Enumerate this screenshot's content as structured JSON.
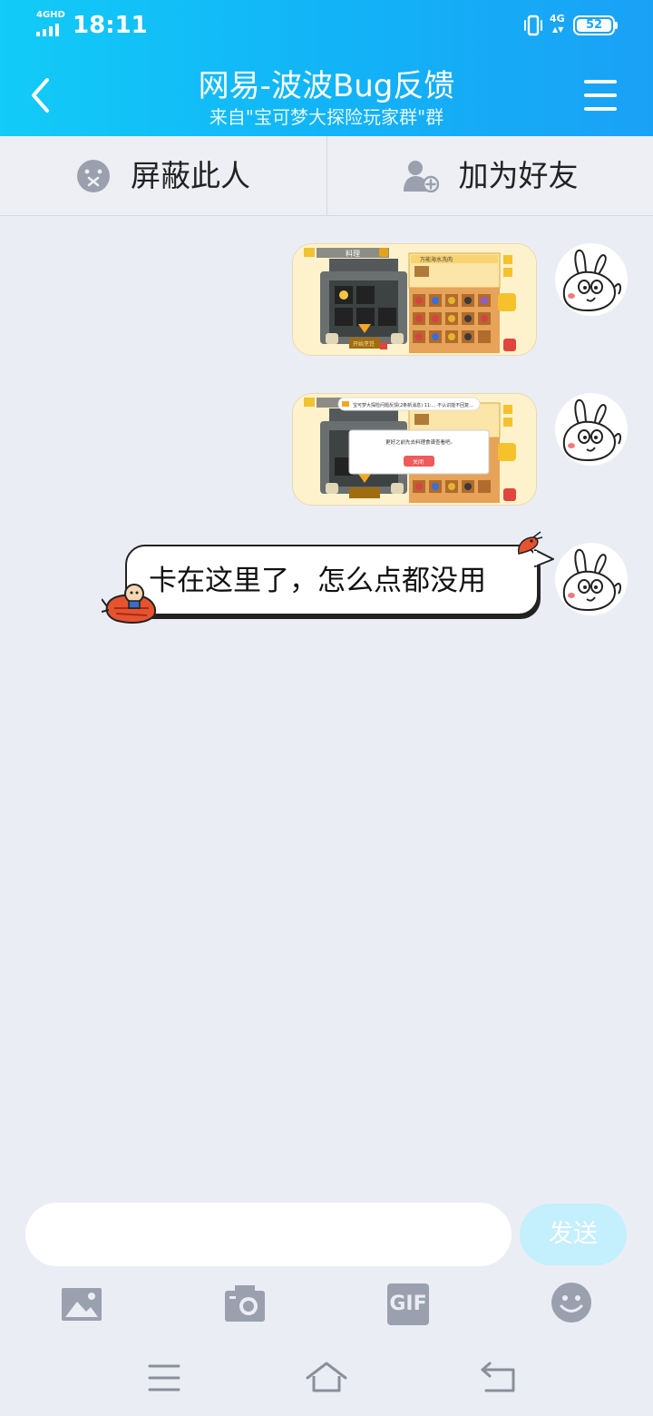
{
  "status_bar": {
    "network_label": "4GHD",
    "time": "18:11",
    "data_label": "4G",
    "battery": "52"
  },
  "header": {
    "title": "网易-波波Bug反馈",
    "subtitle": "来自\"宝可梦大探险玩家群\"群"
  },
  "actions": {
    "block_label": "屏蔽此人",
    "add_friend_label": "加为好友"
  },
  "messages": {
    "screenshot1": {
      "panel_title": "料理",
      "cook_button": "开始烹饪",
      "recipe_label": "万能海水洗肉"
    },
    "screenshot2": {
      "dialog_text": "更好之前先去料理食谱查看吧。",
      "dialog_button": "关闭",
      "banner_text": "宝可梦大探险问题反馈(2条新消息) 11:... 不认识能不回复..."
    },
    "text": "卡在这里了，怎么点都没用"
  },
  "input": {
    "placeholder": "",
    "send_label": "发送"
  },
  "toolbar": {
    "icons": [
      "image-icon",
      "camera-icon",
      "gif-icon",
      "emoji-icon"
    ],
    "gif_label": "GIF"
  },
  "nav": {
    "icons": [
      "menu-icon",
      "home-icon",
      "back-icon"
    ]
  },
  "colors": {
    "header_start": "#12cbf7",
    "header_end": "#1aa1f6",
    "background": "#ebedf5",
    "send_button": "#c4effc"
  }
}
